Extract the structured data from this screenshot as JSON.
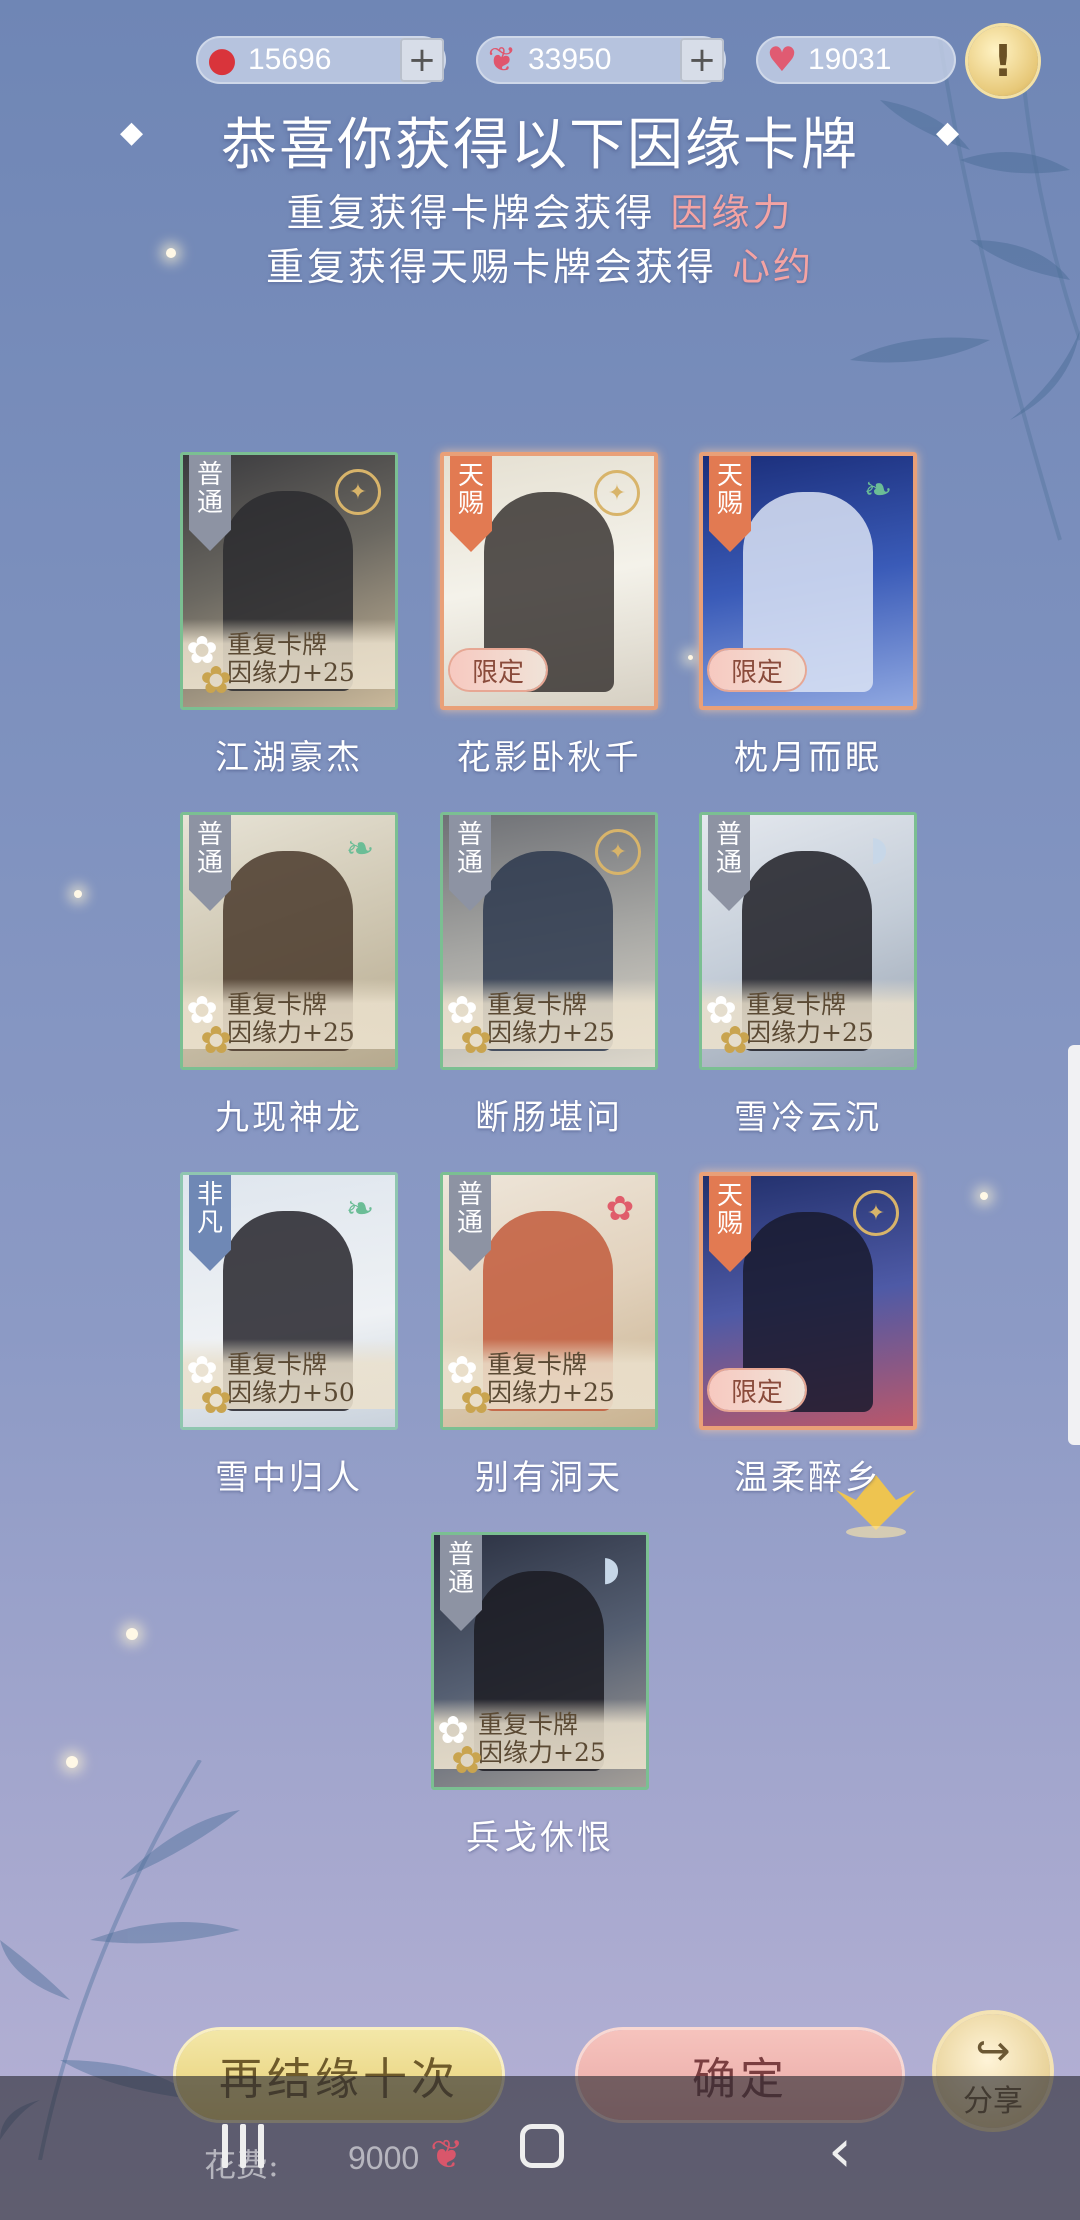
{
  "currencies": [
    {
      "icon": "red-bean-icon",
      "value": "15696",
      "has_plus": true
    },
    {
      "icon": "butterfly-icon",
      "value": "33950",
      "has_plus": true
    },
    {
      "icon": "hearts-icon",
      "value": "19031",
      "has_plus": false
    }
  ],
  "alert_symbol": "!",
  "title": "恭喜你获得以下因缘卡牌",
  "subtitle_1": {
    "text": "重复获得卡牌会获得",
    "highlight": "因缘力"
  },
  "subtitle_2": {
    "text": "重复获得天赐卡牌会获得",
    "highlight": "心约"
  },
  "duplicate_label": "重复卡牌",
  "limited_label": "限定",
  "cards": [
    {
      "name": "江湖豪杰",
      "rarity": "普通",
      "tier": "common",
      "badge": "medal",
      "duplicate": true,
      "bonus": "因缘力+25",
      "limited": false
    },
    {
      "name": "花影卧秋千",
      "rarity": "天赐",
      "tier": "rare",
      "badge": "medal",
      "duplicate": false,
      "bonus": "",
      "limited": true
    },
    {
      "name": "枕月而眠",
      "rarity": "天赐",
      "tier": "rare",
      "badge": "leaf",
      "duplicate": false,
      "bonus": "",
      "limited": true
    },
    {
      "name": "九现神龙",
      "rarity": "普通",
      "tier": "common",
      "badge": "leaf",
      "duplicate": true,
      "bonus": "因缘力+25",
      "limited": false
    },
    {
      "name": "断肠堪问",
      "rarity": "普通",
      "tier": "common",
      "badge": "medal",
      "duplicate": true,
      "bonus": "因缘力+25",
      "limited": false
    },
    {
      "name": "雪冷云沉",
      "rarity": "普通",
      "tier": "common",
      "badge": "fan",
      "duplicate": true,
      "bonus": "因缘力+25",
      "limited": false
    },
    {
      "name": "雪中归人",
      "rarity": "非凡",
      "tier": "special",
      "badge": "leaf",
      "duplicate": true,
      "bonus": "因缘力+50",
      "limited": false
    },
    {
      "name": "别有洞天",
      "rarity": "普通",
      "tier": "common",
      "badge": "flower",
      "duplicate": true,
      "bonus": "因缘力+25",
      "limited": false
    },
    {
      "name": "温柔醉乡",
      "rarity": "天赐",
      "tier": "rare",
      "badge": "medal",
      "duplicate": false,
      "bonus": "",
      "limited": true
    },
    {
      "name": "兵戈休恨",
      "rarity": "普通",
      "tier": "common",
      "badge": "fan",
      "duplicate": true,
      "bonus": "因缘力+25",
      "limited": false
    }
  ],
  "buttons": {
    "again": "再结缘十次",
    "confirm": "确定",
    "share": "分享"
  },
  "cost": {
    "label": "花费:",
    "value": "9000",
    "icon": "butterfly-icon"
  },
  "colors": {
    "highlight": "#f4a3a3",
    "common_border": "#7bbf92",
    "rare_border": "#e9a078",
    "ribbon_rare": "#e27a52",
    "ribbon_common": "#8d93a3"
  }
}
